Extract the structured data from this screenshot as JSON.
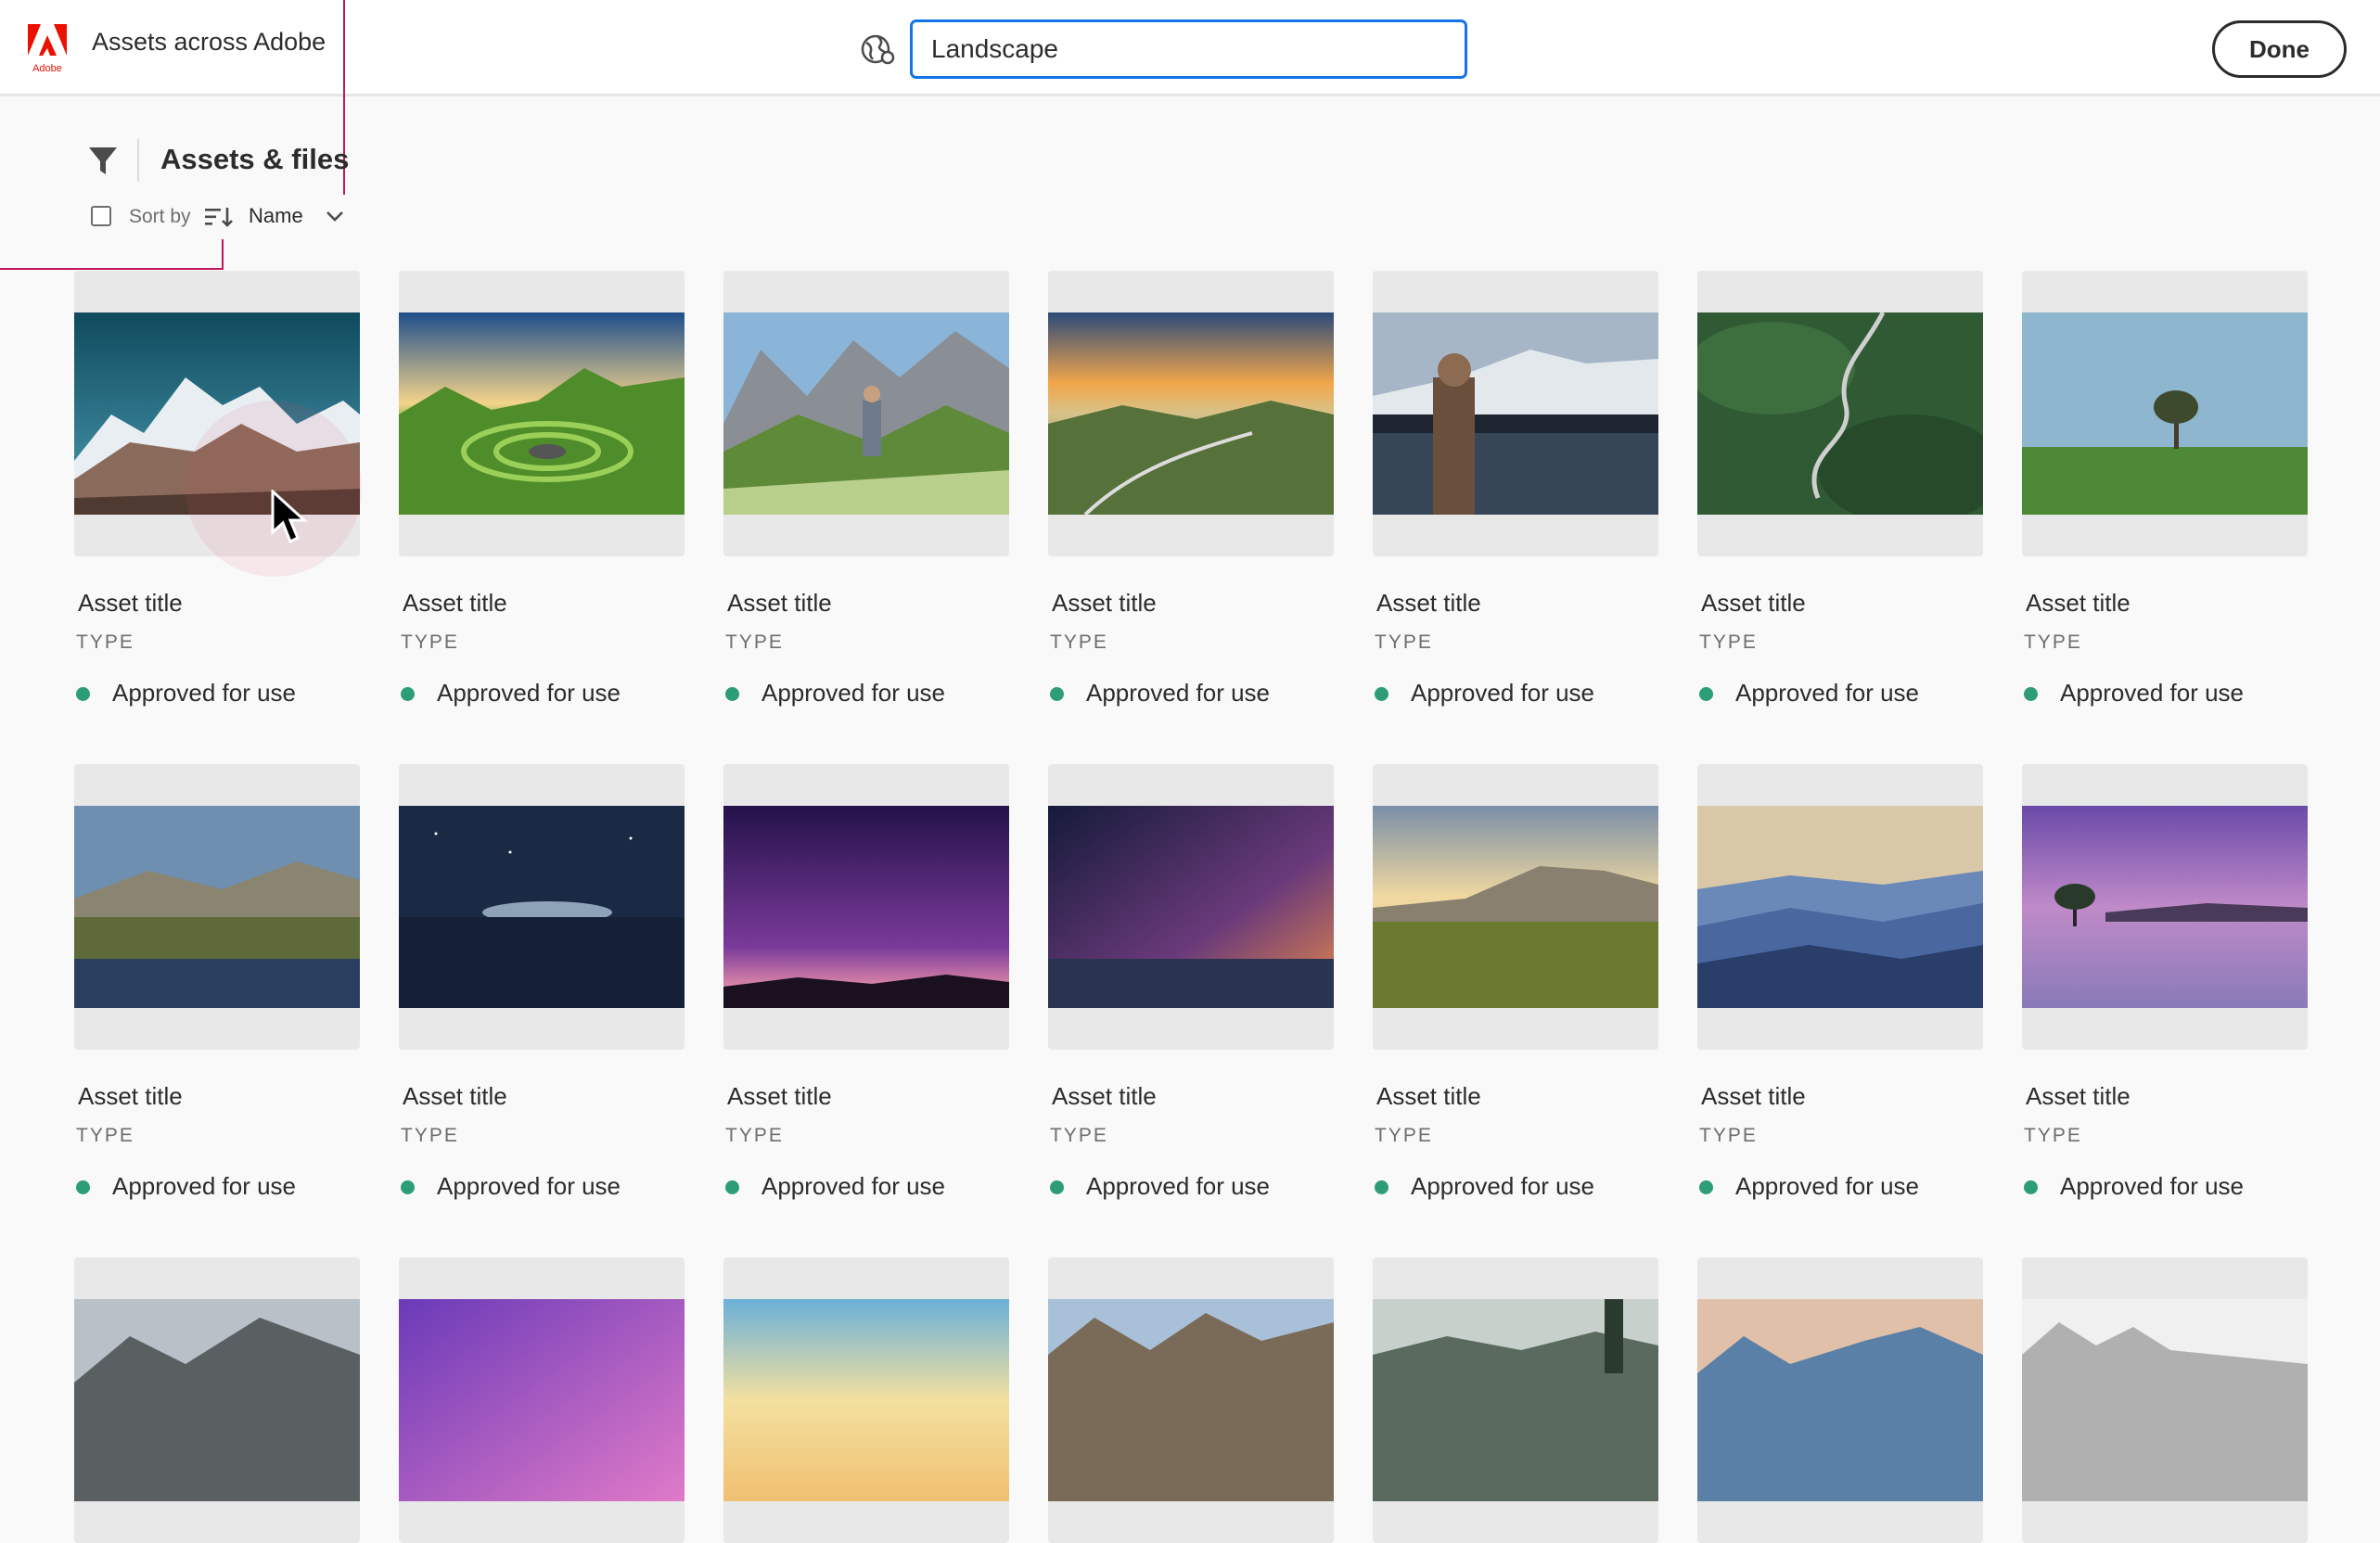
{
  "app": {
    "logo_text": "Adobe",
    "title": "Assets across Adobe"
  },
  "search": {
    "value": "Landscape"
  },
  "header": {
    "done_label": "Done"
  },
  "toolbar": {
    "section_title": "Assets & files",
    "sort_by_label": "Sort by",
    "sort_value": "Name"
  },
  "colors": {
    "accent": "#1473e6",
    "status_approved": "#2d9d78",
    "adobe_red": "#eb1000",
    "guide": "#c2185b"
  },
  "assets": [
    {
      "title": "Asset title",
      "type": "TYPE",
      "status": "Approved for use",
      "scene": "snowy-mountains"
    },
    {
      "title": "Asset title",
      "type": "TYPE",
      "status": "Approved for use",
      "scene": "green-spiral-valley"
    },
    {
      "title": "Asset title",
      "type": "TYPE",
      "status": "Approved for use",
      "scene": "hiker-mountains"
    },
    {
      "title": "Asset title",
      "type": "TYPE",
      "status": "Approved for use",
      "scene": "sunset-hills"
    },
    {
      "title": "Asset title",
      "type": "TYPE",
      "status": "Approved for use",
      "scene": "woman-lake"
    },
    {
      "title": "Asset title",
      "type": "TYPE",
      "status": "Approved for use",
      "scene": "winding-road-aerial"
    },
    {
      "title": "Asset title",
      "type": "TYPE",
      "status": "Approved for use",
      "scene": "lone-tree-field"
    },
    {
      "title": "Asset title",
      "type": "TYPE",
      "status": "Approved for use",
      "scene": "lake-reflection"
    },
    {
      "title": "Asset title",
      "type": "TYPE",
      "status": "Approved for use",
      "scene": "night-boat"
    },
    {
      "title": "Asset title",
      "type": "TYPE",
      "status": "Approved for use",
      "scene": "purple-starry-sky"
    },
    {
      "title": "Asset title",
      "type": "TYPE",
      "status": "Approved for use",
      "scene": "milky-way-lake"
    },
    {
      "title": "Asset title",
      "type": "TYPE",
      "status": "Approved for use",
      "scene": "sunset-meadow"
    },
    {
      "title": "Asset title",
      "type": "TYPE",
      "status": "Approved for use",
      "scene": "blue-mountain-layers"
    },
    {
      "title": "Asset title",
      "type": "TYPE",
      "status": "Approved for use",
      "scene": "tree-in-lake-dusk"
    },
    {
      "scene": "misty-peaks"
    },
    {
      "scene": "purple-sunset"
    },
    {
      "scene": "golden-sky"
    },
    {
      "scene": "rocky-canyon"
    },
    {
      "scene": "foggy-forest"
    },
    {
      "scene": "blue-cliffs"
    },
    {
      "scene": "snowy-fog"
    }
  ]
}
